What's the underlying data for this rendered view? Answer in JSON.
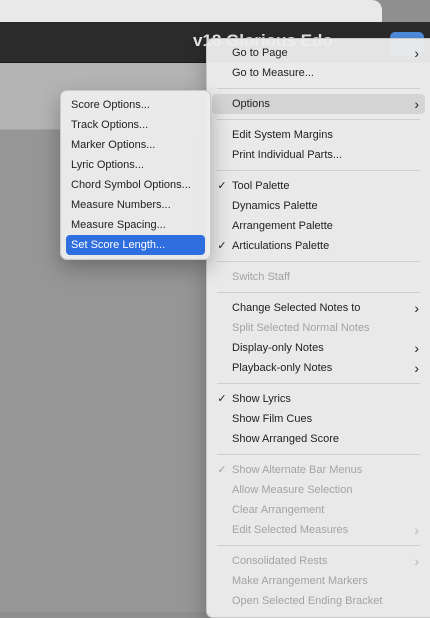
{
  "app": {
    "title": "v18 Glorious Edo"
  },
  "context_menu": {
    "groups": [
      [
        {
          "label": "Go to Page",
          "submenu": true,
          "enabled": true
        },
        {
          "label": "Go to Measure...",
          "submenu": false,
          "enabled": true
        }
      ],
      [
        {
          "label": "Options",
          "submenu": true,
          "enabled": true,
          "highlighted": true
        }
      ],
      [
        {
          "label": "Edit System Margins",
          "enabled": true
        },
        {
          "label": "Print Individual Parts...",
          "enabled": true
        }
      ],
      [
        {
          "label": "Tool Palette",
          "checked": true,
          "enabled": true
        },
        {
          "label": "Dynamics Palette",
          "enabled": true
        },
        {
          "label": "Arrangement Palette",
          "enabled": true
        },
        {
          "label": "Articulations Palette",
          "checked": true,
          "enabled": true
        }
      ],
      [
        {
          "label": "Switch Staff",
          "enabled": false
        }
      ],
      [
        {
          "label": "Change Selected Notes to",
          "submenu": true,
          "enabled": true
        },
        {
          "label": "Split Selected Normal Notes",
          "enabled": false
        },
        {
          "label": "Display-only Notes",
          "submenu": true,
          "enabled": true
        },
        {
          "label": "Playback-only Notes",
          "submenu": true,
          "enabled": true
        }
      ],
      [
        {
          "label": "Show Lyrics",
          "checked": true,
          "enabled": true
        },
        {
          "label": "Show Film Cues",
          "enabled": true
        },
        {
          "label": "Show Arranged Score",
          "enabled": true
        }
      ],
      [
        {
          "label": "Show Alternate Bar Menus",
          "checked": true,
          "enabled": false
        },
        {
          "label": "Allow Measure Selection",
          "enabled": false
        },
        {
          "label": "Clear Arrangement",
          "enabled": false
        },
        {
          "label": "Edit Selected Measures",
          "submenu": true,
          "enabled": false
        }
      ],
      [
        {
          "label": "Consolidated Rests",
          "submenu": true,
          "enabled": false
        },
        {
          "label": "Make Arrangement Markers",
          "enabled": false
        },
        {
          "label": "Open Selected Ending Bracket",
          "enabled": false
        }
      ]
    ]
  },
  "options_submenu": {
    "items": [
      {
        "label": "Score Options..."
      },
      {
        "label": "Track Options..."
      },
      {
        "label": "Marker Options..."
      },
      {
        "label": "Lyric Options..."
      },
      {
        "label": "Chord Symbol Options..."
      },
      {
        "label": "Measure Numbers..."
      },
      {
        "label": "Measure Spacing..."
      },
      {
        "label": "Set Score Length...",
        "selected": true
      }
    ]
  },
  "glyphs": {
    "check": "✓",
    "submenu_arrow": "›"
  },
  "colors": {
    "selection": "#2f6ede",
    "menu_background": "#ececec",
    "disabled_text": "#a3a3a3",
    "titlebar": "#2b2b2b"
  }
}
